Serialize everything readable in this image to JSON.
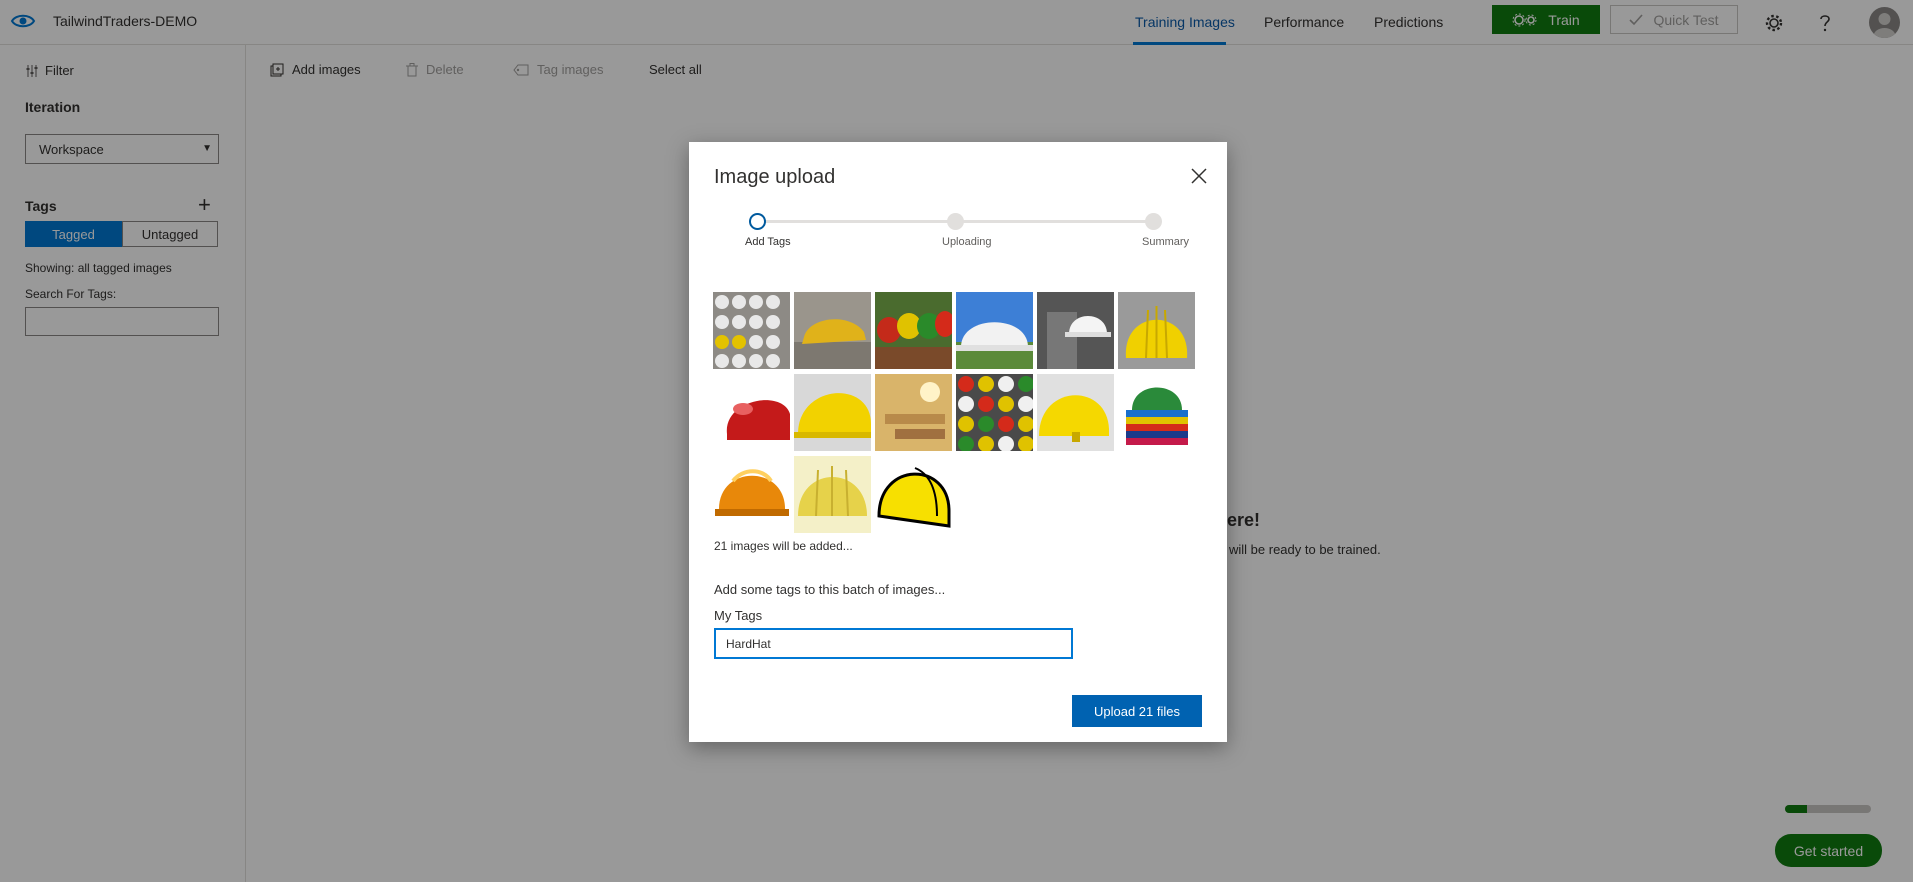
{
  "header": {
    "project_name": "TailwindTraders-DEMO",
    "tabs": [
      {
        "label": "Training Images",
        "active": true
      },
      {
        "label": "Performance",
        "active": false
      },
      {
        "label": "Predictions",
        "active": false
      }
    ],
    "train_label": "Train",
    "quick_test_label": "Quick Test",
    "accent_color": "#0078d4",
    "train_color": "#107c10"
  },
  "sidebar": {
    "filter_label": "Filter",
    "iteration_label": "Iteration",
    "iteration_value": "Workspace",
    "tags_label": "Tags",
    "tagged_label": "Tagged",
    "untagged_label": "Untagged",
    "showing_text": "Showing: all tagged images",
    "search_label": "Search For Tags:"
  },
  "toolbar": {
    "add_images": "Add images",
    "delete": "Delete",
    "tag_images": "Tag images",
    "select_all": "Select all"
  },
  "background": {
    "heading_fragment": "here!",
    "sub_fragment": "will be ready to be trained."
  },
  "footer": {
    "get_started": "Get started",
    "progress_fraction": 0.25
  },
  "dialog": {
    "title": "Image upload",
    "steps": [
      {
        "label": "Add Tags",
        "state": "current"
      },
      {
        "label": "Uploading",
        "state": "pending"
      },
      {
        "label": "Summary",
        "state": "pending"
      }
    ],
    "thumbnails": [
      "white-yellow-hardhats-rack",
      "yellow-hardhat-on-ground",
      "colorful-hardhats-row",
      "white-hardhat-sky",
      "white-hardhat-on-post",
      "yellow-hardhat-front",
      "red-hardhat",
      "yellow-hardhat-closeup",
      "hardhat-workshop",
      "colorful-hardhats-grid",
      "yellow-hardhat-side",
      "stacked-colored-hardhats",
      "orange-hardhat-illustration",
      "yellow-hardhat-clipart",
      "yellow-hardhat-cartoon"
    ],
    "count_text": "21 images will be added...",
    "batch_text": "Add some tags to this batch of images...",
    "my_tags_label": "My Tags",
    "tag_value": "HardHat",
    "upload_label": "Upload 21 files"
  }
}
